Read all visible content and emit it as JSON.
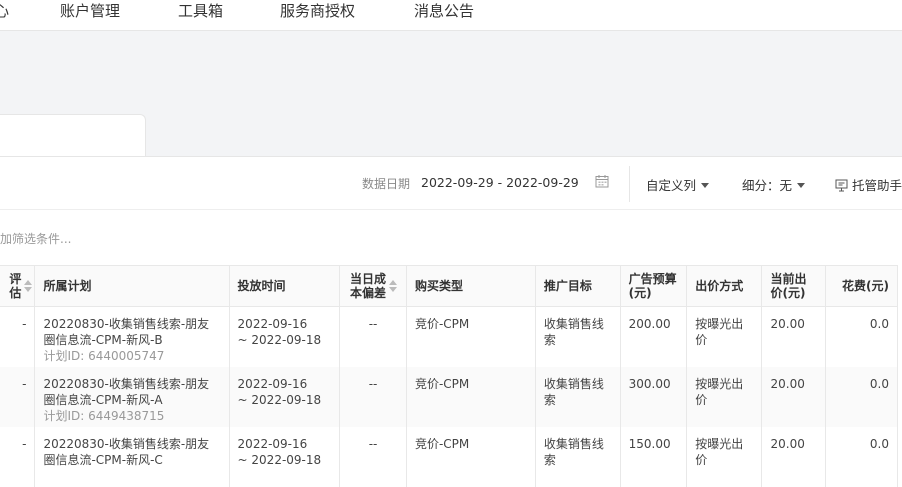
{
  "nav": {
    "items": [
      "心",
      "账户管理",
      "工具箱",
      "服务商授权",
      "消息公告"
    ]
  },
  "toolbar": {
    "date_label": "数据日期",
    "date_range": "2022-09-29 - 2022-09-29",
    "custom_columns": "自定义列",
    "breakdown": "细分：无",
    "assistant": "托管助手"
  },
  "filter": {
    "placeholder": "加筛选条件..."
  },
  "table": {
    "headers": [
      "评估",
      "所属计划",
      "投放时间",
      "当日成本偏差",
      "购买类型",
      "推广目标",
      "广告预算(元)",
      "出价方式",
      "当前出价(元)",
      "花费(元)"
    ],
    "rows": [
      {
        "eval": "-",
        "plan": "20220830-收集销售线索-朋友圈信息流-CPM-新风-B",
        "plan_id": "计划ID: 6440005747",
        "time_start": "2022-09-16",
        "time_end": "~ 2022-09-18",
        "deviation": "--",
        "buy_type": "竞价-CPM",
        "goal": "收集销售线索",
        "budget": "200.00",
        "bid_method": "按曝光出价",
        "bid": "20.00",
        "spend": "0.0"
      },
      {
        "eval": "-",
        "plan": "20220830-收集销售线索-朋友圈信息流-CPM-新风-A",
        "plan_id": "计划ID: 6449438715",
        "time_start": "2022-09-16",
        "time_end": "~ 2022-09-18",
        "deviation": "--",
        "buy_type": "竞价-CPM",
        "goal": "收集销售线索",
        "budget": "300.00",
        "bid_method": "按曝光出价",
        "bid": "20.00",
        "spend": "0.0"
      },
      {
        "eval": "-",
        "plan": "20220830-收集销售线索-朋友圈信息流-CPM-新风-C",
        "plan_id": "",
        "time_start": "2022-09-16",
        "time_end": "~ 2022-09-18",
        "deviation": "--",
        "buy_type": "竞价-CPM",
        "goal": "收集销售线索",
        "budget": "150.00",
        "bid_method": "按曝光出价",
        "bid": "20.00",
        "spend": "0.0"
      }
    ]
  }
}
